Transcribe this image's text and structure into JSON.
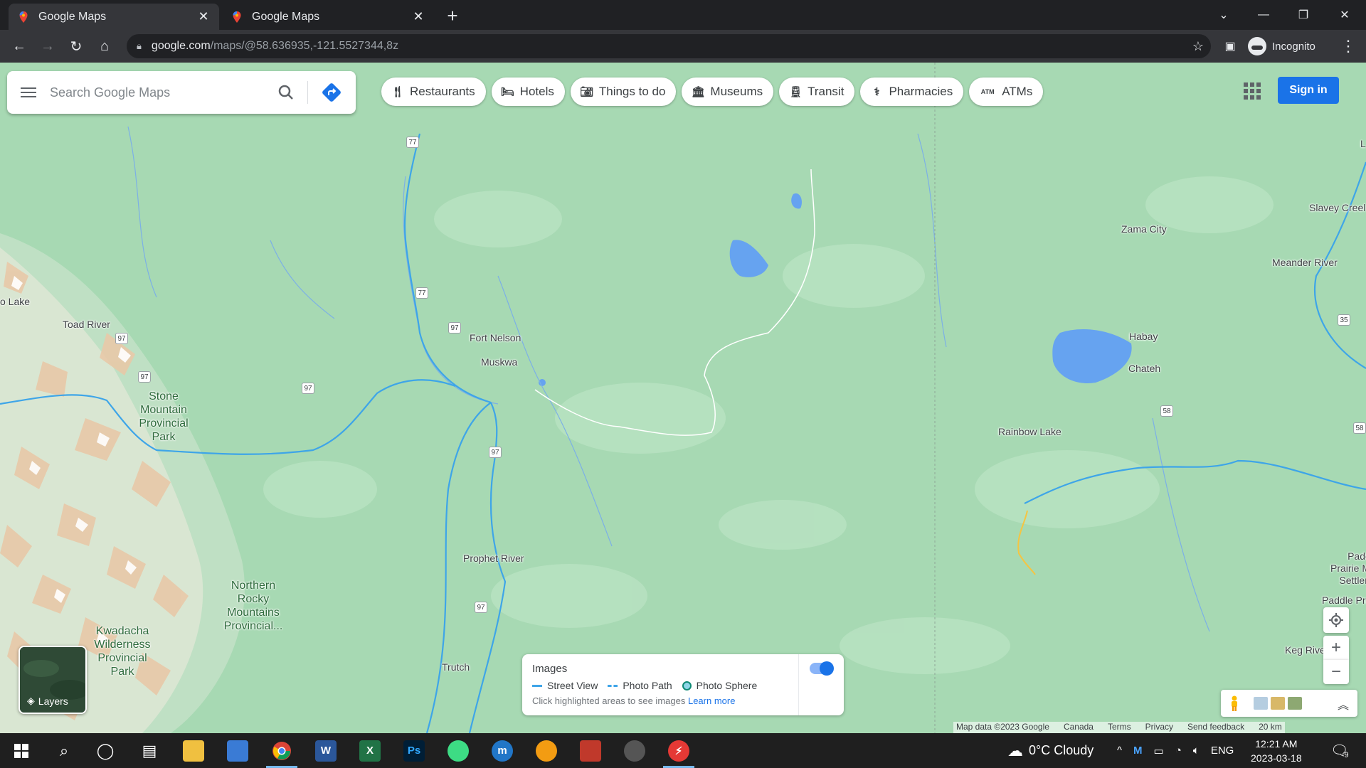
{
  "browser": {
    "tabs": [
      {
        "title": "Google Maps",
        "active": true
      },
      {
        "title": "Google Maps",
        "active": false
      }
    ],
    "url_host": "google.com",
    "url_path": "/maps/@58.636935,-121.5527344,8z",
    "profile_label": "Incognito"
  },
  "maps": {
    "search_placeholder": "Search Google Maps",
    "chips": [
      {
        "label": "Restaurants",
        "icon": "restaurant-icon"
      },
      {
        "label": "Hotels",
        "icon": "hotel-icon"
      },
      {
        "label": "Things to do",
        "icon": "camera-icon"
      },
      {
        "label": "Museums",
        "icon": "museum-icon"
      },
      {
        "label": "Transit",
        "icon": "transit-icon"
      },
      {
        "label": "Pharmacies",
        "icon": "pharmacy-icon"
      },
      {
        "label": "ATMs",
        "icon": "atm-icon"
      }
    ],
    "sign_in": "Sign in",
    "layers_label": "Layers",
    "places": {
      "fort_nelson": "Fort Nelson",
      "muskwa": "Muskwa",
      "toad_river": "Toad River",
      "o_lake": "o Lake",
      "prophet_river": "Prophet River",
      "trutch": "Trutch",
      "zama_city": "Zama City",
      "slavey_creek": "Slavey Creel",
      "meander_river": "Meander River",
      "habay": "Habay",
      "chateh": "Chateh",
      "rainbow_lake": "Rainbow Lake",
      "keg_river": "Keg River",
      "paddle_prairie": "Paddle Prair",
      "padd_frag": "Padc\nPrairie M\nSettlen",
      "l_frag": "L"
    },
    "parks": {
      "stone_mountain": "Stone\nMountain\nProvincial\nPark",
      "northern_rocky": "Northern\nRocky\nMountains\nProvincial...",
      "kwadacha": "Kwadacha\nWilderness\nProvincial\nPark"
    },
    "highways": {
      "h77": "77",
      "h97": "97",
      "h58": "58",
      "h35": "35"
    },
    "images_panel": {
      "title": "Images",
      "street_view": "Street View",
      "photo_path": "Photo Path",
      "photo_sphere": "Photo Sphere",
      "hint": "Click highlighted areas to see images",
      "learn_more": "Learn more",
      "toggle_on": true
    },
    "attribution": [
      "Map data ©2023 Google",
      "Canada",
      "Terms",
      "Privacy",
      "Send feedback",
      "20 km"
    ]
  },
  "taskbar": {
    "weather": "0°C  Cloudy",
    "lang": "ENG",
    "time": "12:21 AM",
    "date": "2023-03-18",
    "notifications": "9"
  },
  "colors": {
    "map_bg": "#a7d9b3",
    "water": "#66a3f0",
    "road_blue": "#3ea5e8",
    "accent": "#1a73e8"
  }
}
